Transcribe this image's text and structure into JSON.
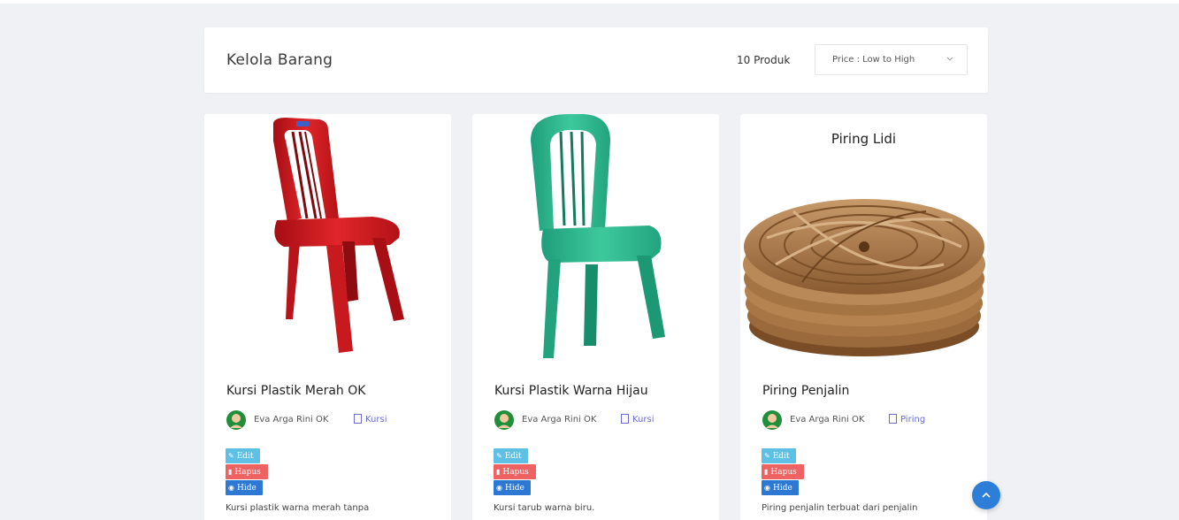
{
  "header": {
    "title": "Kelola Barang",
    "count": "10 Produk",
    "sort_label": "Price : Low to High"
  },
  "colors": {
    "background": "#f0f1f5",
    "edit": "#5fc0e6",
    "hapus": "#ef6262",
    "hide": "#2d78d3",
    "fab": "#2d7ed8",
    "category_link": "#6b6bd0"
  },
  "products": [
    {
      "name": "Kursi Plastik Merah OK",
      "author": "Eva Arga Rini OK",
      "category": "Kursi",
      "edit": "Edit",
      "hapus": "Hapus",
      "hide": "Hide",
      "description": "Kursi plastik warna merah tanpa",
      "image": "red-plastic-chair"
    },
    {
      "name": "Kursi Plastik Warna Hijau",
      "author": "Eva Arga Rini OK",
      "category": "Kursi",
      "edit": "Edit",
      "hapus": "Hapus",
      "hide": "Hide",
      "description": "Kursi tarub warna biru.",
      "image": "green-plastic-chair"
    },
    {
      "name": "Piring Penjalin",
      "author": "Eva Arga Rini OK",
      "category": "Piring",
      "edit": "Edit",
      "hapus": "Hapus",
      "hide": "Hide",
      "description": "Piring penjalin terbuat dari penjalin",
      "image_caption": "Piring Lidi",
      "image": "woven-rattan-plates"
    }
  ],
  "scroll_top_icon": "chevron-up-icon"
}
